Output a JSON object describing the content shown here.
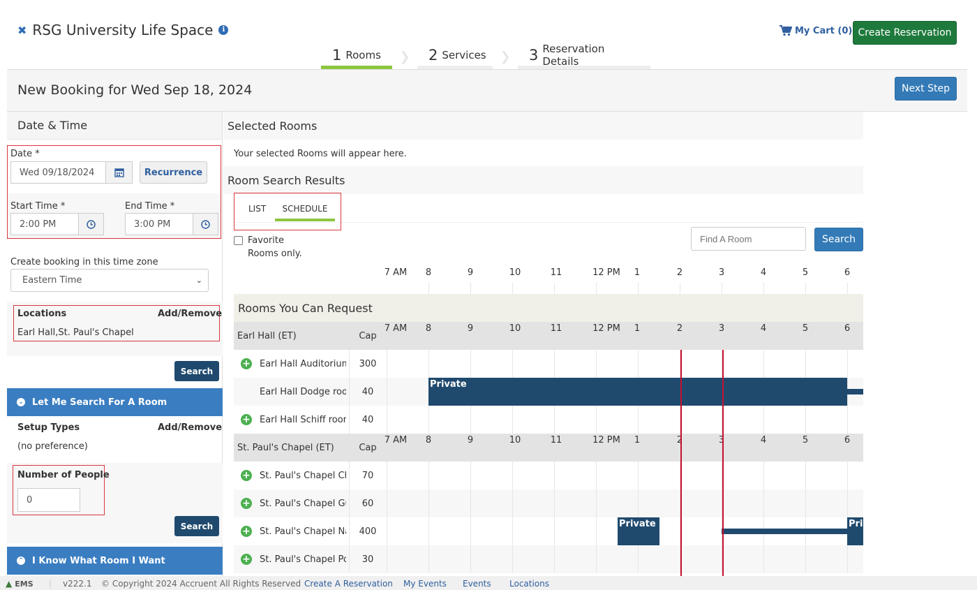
{
  "header": {
    "title": "RSG University Life Space",
    "cart_label": "My Cart (0)",
    "create_button": "Create Reservation"
  },
  "steps": [
    {
      "num": "1",
      "label": "Rooms"
    },
    {
      "num": "2",
      "label": "Services"
    },
    {
      "num": "3",
      "label": "Reservation Details"
    }
  ],
  "banner": {
    "title": "New Booking for Wed Sep 18, 2024",
    "next_button": "Next Step"
  },
  "left": {
    "section_title": "Date & Time",
    "date_label": "Date *",
    "date_value": "Wed 09/18/2024",
    "recurrence": "Recurrence",
    "start_label": "Start Time *",
    "start_value": "2:00 PM",
    "end_label": "End Time *",
    "end_value": "3:00 PM",
    "tz_label": "Create booking in this time zone",
    "tz_value": "Eastern Time",
    "locations_label": "Locations",
    "locations_add": "Add/Remove",
    "locations_value": "Earl Hall,St. Paul's Chapel",
    "search1": "Search",
    "accordion1": "Let Me Search For A Room",
    "setup_label": "Setup Types",
    "setup_add": "Add/Remove",
    "setup_value": "(no preference)",
    "people_label": "Number of People",
    "people_value": "0",
    "search2": "Search",
    "accordion2": "I Know What Room I Want"
  },
  "right": {
    "selected_title": "Selected Rooms",
    "selected_empty": "Your selected Rooms will appear here.",
    "results_title": "Room Search Results",
    "tab_list": "LIST",
    "tab_schedule": "SCHEDULE",
    "favorite_label": "Favorite",
    "favorite_label2": "Rooms only.",
    "find_placeholder": "Find A Room",
    "search": "Search",
    "hours": [
      "7 AM",
      "8",
      "9",
      "10",
      "11",
      "12 PM",
      "1",
      "2",
      "3",
      "4",
      "5",
      "6"
    ],
    "request_title": "Rooms You Can Request",
    "cap_label": "Cap",
    "groups": [
      {
        "name": "Earl Hall (ET)",
        "rooms": [
          {
            "name": "Earl Hall Auditorium",
            "cap": "300",
            "plus": true
          },
          {
            "name": "Earl Hall Dodge room",
            "cap": "40",
            "plus": false
          },
          {
            "name": "Earl Hall Schiff room",
            "cap": "40",
            "plus": true
          }
        ]
      },
      {
        "name": "St. Paul's Chapel (ET)",
        "rooms": [
          {
            "name": "St. Paul's Chapel Choir",
            "cap": "70",
            "plus": true
          },
          {
            "name": "St. Paul's Chapel Guest",
            "cap": "60",
            "plus": true
          },
          {
            "name": "St. Paul's Chapel Nave",
            "cap": "400",
            "plus": true
          },
          {
            "name": "St. Paul's Chapel Post",
            "cap": "30",
            "plus": true
          }
        ]
      }
    ],
    "booking_label": "Private",
    "booking_label_cut": "Priv"
  },
  "footer": {
    "brand": "EMS",
    "version": "v222.1",
    "copyright": "© Copyright 2024 Accruent All Rights Reserved",
    "links": [
      "Create A Reservation",
      "My Events",
      "Events",
      "Locations"
    ]
  }
}
